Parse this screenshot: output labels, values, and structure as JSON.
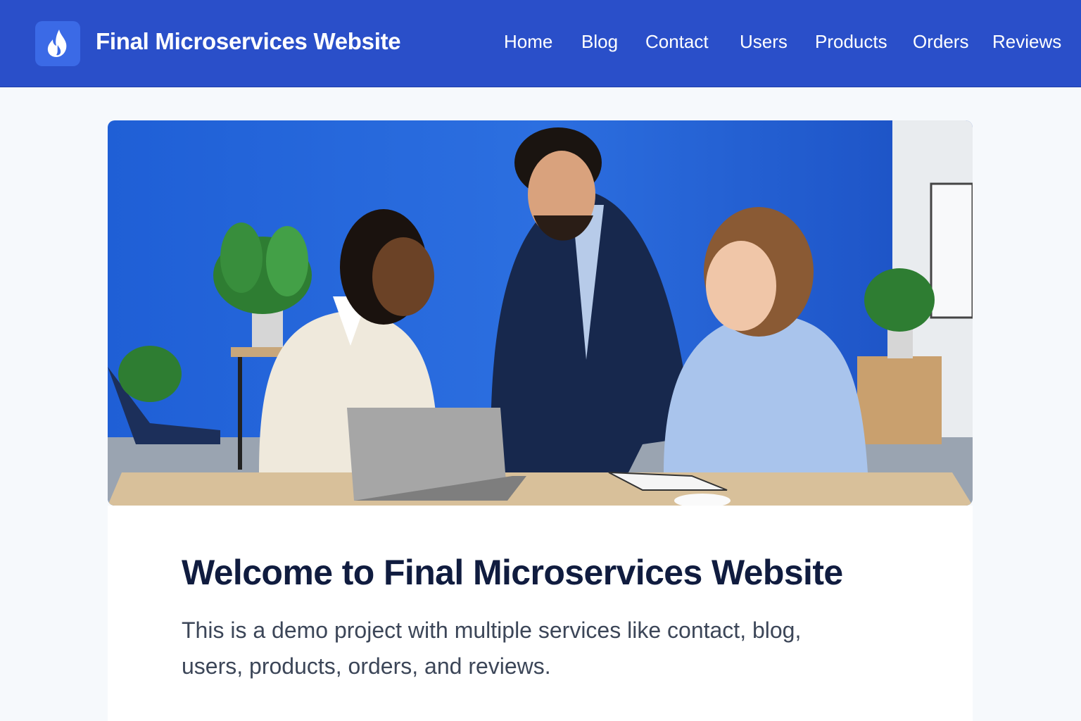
{
  "header": {
    "brand": "Final Microservices Website",
    "nav": [
      {
        "label": "Home"
      },
      {
        "label": "Blog"
      },
      {
        "label": "Contact"
      },
      {
        "label": "Users"
      },
      {
        "label": "Products"
      },
      {
        "label": "Orders"
      },
      {
        "label": "Reviews"
      }
    ]
  },
  "hero": {
    "image": "team-at-laptop-photo"
  },
  "main": {
    "title": "Welcome to Final Microservices Website",
    "description": "This is a demo project with multiple services like contact, blog, users, products, orders, and reviews."
  },
  "colors": {
    "navbar": "#2a4fc9",
    "title": "#101c3f",
    "text": "#3c4658",
    "page_bg": "#f6f9fc"
  }
}
